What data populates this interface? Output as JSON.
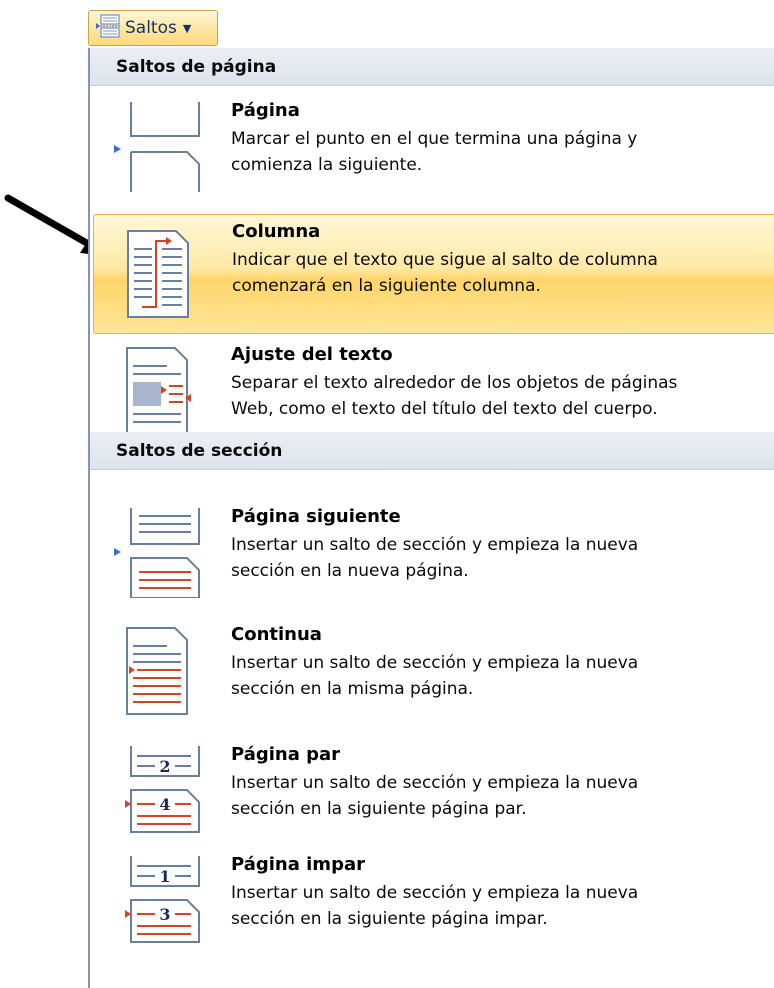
{
  "ribbon_button": {
    "label": "Saltos",
    "icon": "page-break-icon"
  },
  "menu": {
    "sections": [
      {
        "header": "Saltos de página",
        "items": [
          {
            "title": "Página",
            "desc_1": "Marcar el punto en el que termina una página y",
            "desc_2": "comienza la siguiente.",
            "icon": "page-break-icon"
          },
          {
            "title": "Columna",
            "desc_1": "Indicar que el texto que sigue al salto de columna",
            "desc_2": "comenzará en la siguiente columna.",
            "icon": "column-break-icon",
            "highlighted": true
          },
          {
            "title": "Ajuste del texto",
            "desc_1": "Separar el texto alrededor de los objetos de páginas",
            "desc_2": "Web, como el texto del título del texto del cuerpo.",
            "icon": "text-wrapping-icon"
          }
        ]
      },
      {
        "header": "Saltos de sección",
        "items": [
          {
            "title": "Página siguiente",
            "desc_1": "Insertar un salto de sección y empieza la nueva",
            "desc_2": "sección en la nueva página.",
            "icon": "next-page-icon"
          },
          {
            "title": "Continua",
            "desc_1": "Insertar un salto de sección y empieza la nueva",
            "desc_2": "sección en la misma página.",
            "icon": "continuous-icon"
          },
          {
            "title": "Página par",
            "desc_1": "Insertar un salto de sección y empieza la nueva",
            "desc_2": "sección en la siguiente página par.",
            "icon": "even-page-icon",
            "num_top": "2",
            "num_bottom": "4"
          },
          {
            "title": "Página impar",
            "desc_1": "Insertar un salto de sección y empieza la nueva",
            "desc_2": "sección en la siguiente página impar.",
            "icon": "odd-page-icon",
            "num_top": "1",
            "num_bottom": "3"
          }
        ]
      }
    ]
  },
  "colors": {
    "highlight": "#ffe9a6",
    "highlight_border": "#e3b24a",
    "header_bg": "#dde3ec",
    "accent_red": "#d0452c",
    "accent_blue": "#3a6fd0"
  }
}
